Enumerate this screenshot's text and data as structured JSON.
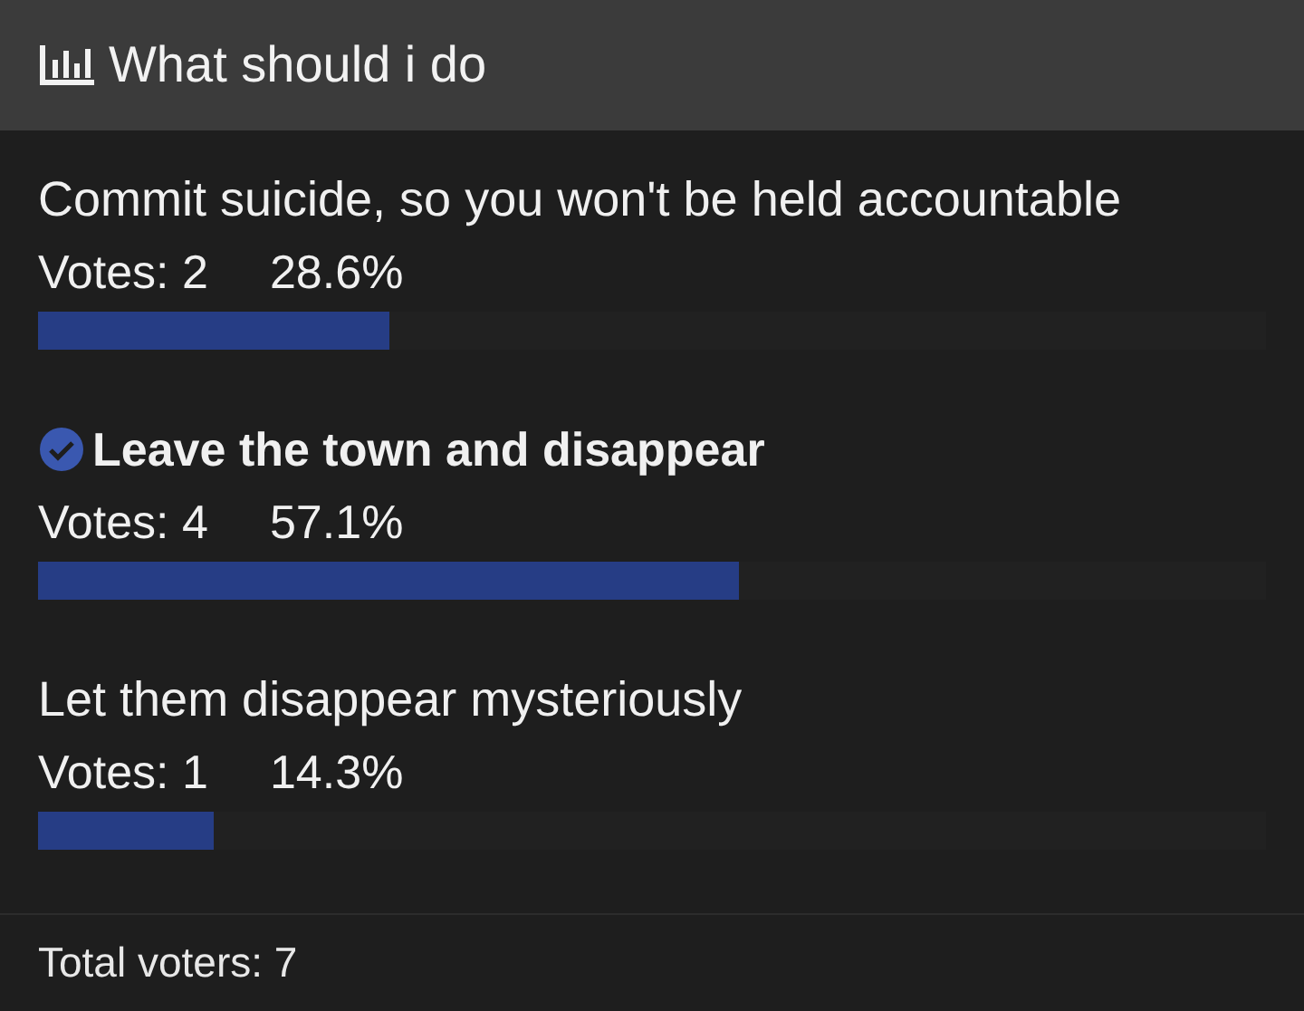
{
  "poll": {
    "title": "What should i do",
    "options": [
      {
        "label": "Commit suicide, so you won't be held accountable",
        "votes": "Votes: 2",
        "percent": "28.6%",
        "level": 0.286,
        "selected": false
      },
      {
        "label": "Leave the town and disappear",
        "votes": "Votes: 4",
        "percent": "57.1%",
        "level": 0.571,
        "selected": true
      },
      {
        "label": "Let them disappear mysteriously",
        "votes": "Votes: 1",
        "percent": "14.3%",
        "level": 0.143,
        "selected": false
      }
    ],
    "total": "Total voters: 7"
  }
}
